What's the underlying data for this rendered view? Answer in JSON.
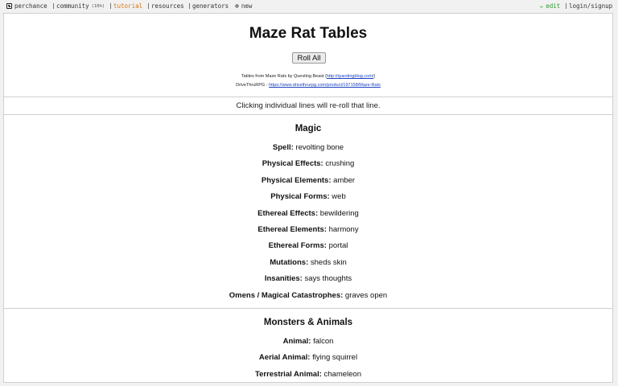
{
  "nav": {
    "left": [
      {
        "label": "perchance",
        "icon": "dice-icon"
      },
      {
        "label": "community",
        "badge": "(10h)"
      },
      {
        "label": "tutorial"
      },
      {
        "label": "resources"
      },
      {
        "label": "generators"
      },
      {
        "label": "new",
        "icon": "plus-circle-icon"
      }
    ],
    "right": [
      {
        "label": "edit",
        "icon": "pencil-icon"
      },
      {
        "label": "login/signup"
      }
    ]
  },
  "page": {
    "title": "Maze Rat Tables",
    "roll_all": "Roll All",
    "credit_line1_prefix": "Tables from Maze Rats by Questing Beast (",
    "credit_line1_link": "http://questingblog.com/",
    "credit_line1_suffix": ")",
    "credit_line2_prefix": "DriveThruRPG - ",
    "credit_line2_link": "https://www.drivethrurpg.com/product/197158/Maze-Rats",
    "hint": "Clicking individual lines will re-roll that line."
  },
  "sections": [
    {
      "title": "Magic",
      "rows": [
        {
          "label": "Spell:",
          "value": "revolting bone"
        },
        {
          "label": "Physical Effects:",
          "value": "crushing"
        },
        {
          "label": "Physical Elements:",
          "value": "amber"
        },
        {
          "label": "Physical Forms:",
          "value": "web"
        },
        {
          "label": "Ethereal Effects:",
          "value": "bewildering"
        },
        {
          "label": "Ethereal Elements:",
          "value": "harmony"
        },
        {
          "label": "Ethereal Forms:",
          "value": "portal"
        },
        {
          "label": "Mutations:",
          "value": "sheds skin"
        },
        {
          "label": "Insanities:",
          "value": "says thoughts"
        },
        {
          "label": "Omens / Magical Catastrophes:",
          "value": "graves open"
        }
      ]
    },
    {
      "title": "Monsters & Animals",
      "rows": [
        {
          "label": "Animal:",
          "value": "falcon"
        },
        {
          "label": "Aerial Animal:",
          "value": "flying squirrel"
        },
        {
          "label": "Terrestrial Animal:",
          "value": "chameleon"
        }
      ]
    }
  ]
}
